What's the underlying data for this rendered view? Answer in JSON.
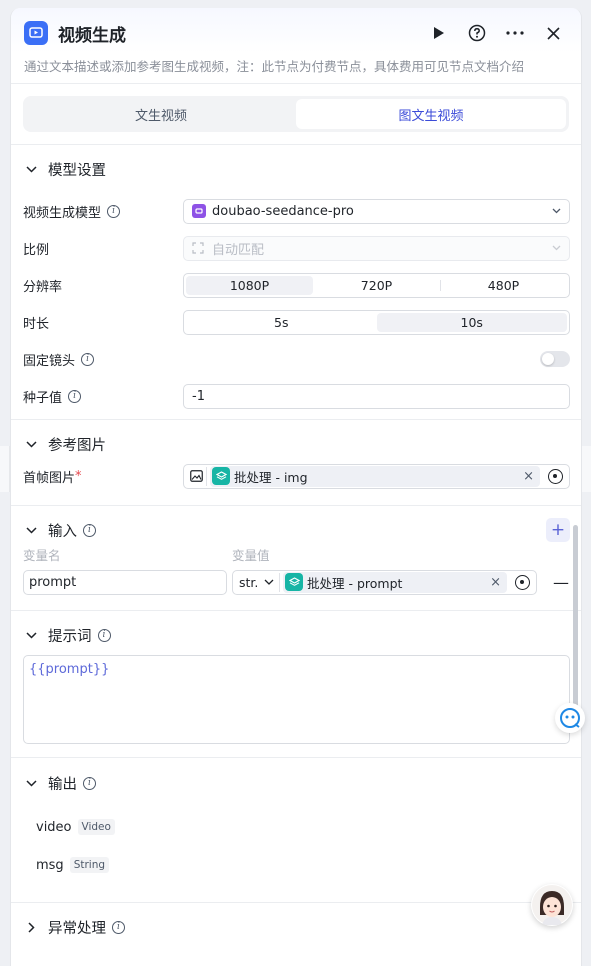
{
  "header": {
    "title": "视频生成",
    "description": "通过文本描述或添加参考图生成视频，注：此节点为付费节点，具体费用可见节点文档介绍"
  },
  "tabs": [
    {
      "label": "文生视频",
      "active": false
    },
    {
      "label": "图文生视频",
      "active": true
    }
  ],
  "model_settings": {
    "title": "模型设置",
    "model": {
      "label": "视频生成模型",
      "value": "doubao-seedance-pro"
    },
    "ratio": {
      "label": "比例",
      "value": "自动匹配"
    },
    "resolution": {
      "label": "分辨率",
      "options": [
        "1080P",
        "720P",
        "480P"
      ],
      "selected": "1080P"
    },
    "duration": {
      "label": "时长",
      "options": [
        "5s",
        "10s"
      ],
      "selected": "10s"
    },
    "fixed_camera": {
      "label": "固定镜头",
      "enabled": false
    },
    "seed": {
      "label": "种子值",
      "value": "-1"
    }
  },
  "reference": {
    "title": "参考图片",
    "first_frame": {
      "label": "首帧图片",
      "required_mark": "*",
      "value": "批处理 - img"
    }
  },
  "inputs": {
    "title": "输入",
    "col_name": "变量名",
    "col_value": "变量值",
    "rows": [
      {
        "name": "prompt",
        "type": "str.",
        "value": "批处理 - prompt"
      }
    ]
  },
  "prompt": {
    "title": "提示词",
    "value": "{{prompt}}"
  },
  "outputs": {
    "title": "输出",
    "items": [
      {
        "name": "video",
        "type": "Video"
      },
      {
        "name": "msg",
        "type": "String"
      }
    ]
  },
  "exception": {
    "title": "异常处理"
  },
  "colors": {
    "accent": "#3b6ff6",
    "chip_icon": "#17b5a5",
    "tab_active_text": "#3b4bd8"
  }
}
